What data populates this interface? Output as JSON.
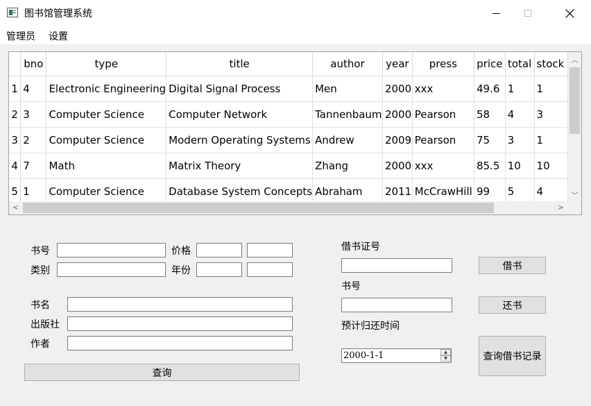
{
  "window": {
    "title": "图书馆管理系统",
    "minimize_label": "",
    "maximize_label": "",
    "close_label": "✕"
  },
  "menu": {
    "admin": "管理员",
    "settings": "设置"
  },
  "table": {
    "columns": [
      "bno",
      "type",
      "title",
      "author",
      "year",
      "press",
      "price",
      "total",
      "stock"
    ],
    "row_headers": [
      "1",
      "2",
      "3",
      "4",
      "5"
    ],
    "rows": [
      [
        "4",
        "Electronic Engineering",
        "Digital Signal Process",
        "Men",
        "2000",
        "xxx",
        "49.6",
        "1",
        "1"
      ],
      [
        "3",
        "Computer Science",
        "Computer Network",
        "Tannenbaum",
        "2000",
        "Pearson",
        "58",
        "4",
        "3"
      ],
      [
        "2",
        "Computer Science",
        "Modern Operating Systems",
        "Andrew",
        "2009",
        "Pearson",
        "75",
        "3",
        "1"
      ],
      [
        "7",
        "Math",
        "Matrix Theory",
        "Zhang",
        "2000",
        "xxx",
        "85.5",
        "10",
        "10"
      ],
      [
        "1",
        "Computer Science",
        "Database System Concepts",
        "Abraham",
        "2011",
        "McCrawHill",
        "99",
        "5",
        "4"
      ]
    ],
    "scroll_up_icon": "▲",
    "scroll_down_icon": "▼",
    "scroll_left_icon": "<",
    "scroll_right_icon": ">",
    "scroll_up_glyph": "︿",
    "scroll_down_glyph": "﹀"
  },
  "search_form": {
    "book_no_label": "书号",
    "price_label": "价格",
    "type_label": "类别",
    "year_label": "年份",
    "title_label": "书名",
    "press_label": "出版社",
    "author_label": "作者",
    "book_no_value": "",
    "price_min_value": "",
    "price_max_value": "",
    "type_value": "",
    "year_min_value": "",
    "year_max_value": "",
    "title_value": "",
    "press_value": "",
    "author_value": "",
    "query_button": "查询"
  },
  "borrow_form": {
    "card_no_label": "借书证号",
    "card_no_value": "",
    "borrow_button": "借书",
    "book_no_label": "书号",
    "book_no_value": "",
    "return_button": "还书",
    "due_label": "预计归还时间",
    "due_value": "2000-1-1",
    "records_button": "查询借书记录"
  }
}
